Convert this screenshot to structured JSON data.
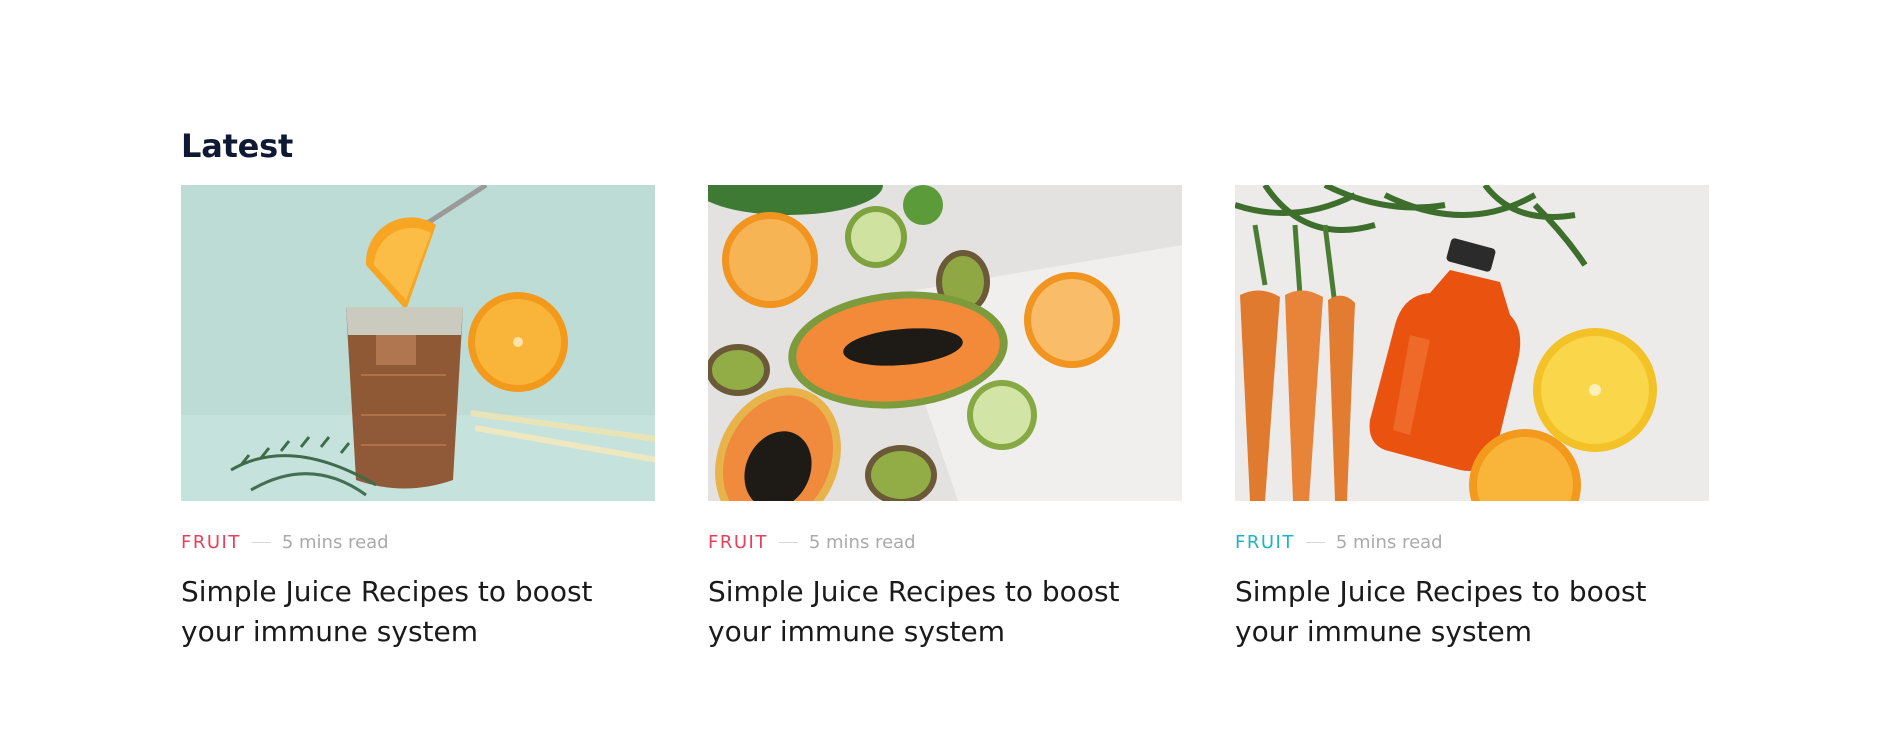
{
  "section": {
    "title": "Latest"
  },
  "cards": [
    {
      "tag": "FRUIT",
      "tag_color": "#e8405a",
      "read_time": "5 mins read",
      "title": "Simple Juice Recipes to boost your immune system",
      "image": "iced-tea-with-orange-slice"
    },
    {
      "tag": "FRUIT",
      "tag_color": "#e8405a",
      "read_time": "5 mins read",
      "title": "Simple Juice Recipes to boost your immune system",
      "image": "papaya-kiwi-citrus-flatlay"
    },
    {
      "tag": "FRUIT",
      "tag_color": "#1fb3c6",
      "read_time": "5 mins read",
      "title": "Simple Juice Recipes to boost your immune system",
      "image": "carrot-juice-bottle-with-oranges"
    }
  ]
}
